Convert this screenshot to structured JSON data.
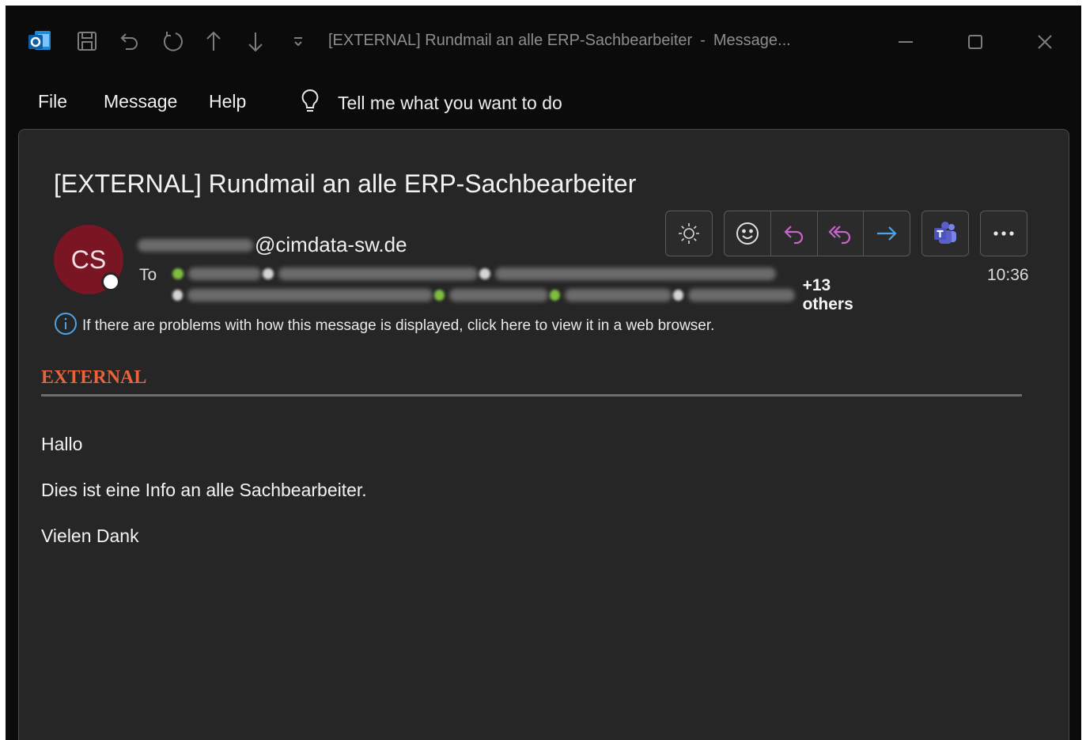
{
  "window": {
    "title": "[EXTERNAL] Rundmail an alle ERP-Sachbearbeiter",
    "title_separator": "-",
    "title_suffix": "Message..."
  },
  "quick_access": [
    "outlook-logo",
    "save-icon",
    "undo-icon",
    "redo-icon",
    "up-arrow-icon",
    "down-arrow-icon",
    "customize-dropdown-icon"
  ],
  "menu": {
    "items": [
      {
        "label": "File"
      },
      {
        "label": "Message"
      },
      {
        "label": "Help"
      }
    ],
    "tell_me": "Tell me what you want to do"
  },
  "message": {
    "subject": "[EXTERNAL] Rundmail an alle ERP-Sachbearbeiter",
    "avatar_initials": "CS",
    "sender_domain": "@cimdata-sw.de",
    "to_label": "To",
    "others": "+13 others",
    "time": "10:36",
    "info_bar": "If there are problems with how this message is displayed, click here to view it in a web browser.",
    "external_label": "EXTERNAL",
    "body": [
      "Hallo",
      "Dies ist eine Info an alle Sachbearbeiter.",
      "Vielen Dank"
    ]
  },
  "colors": {
    "accent_reply": "#c865c8",
    "accent_forward": "#4ea3e6",
    "avatar": "#7a1524",
    "external": "#e8643e",
    "teams": "#5b5fc7"
  }
}
